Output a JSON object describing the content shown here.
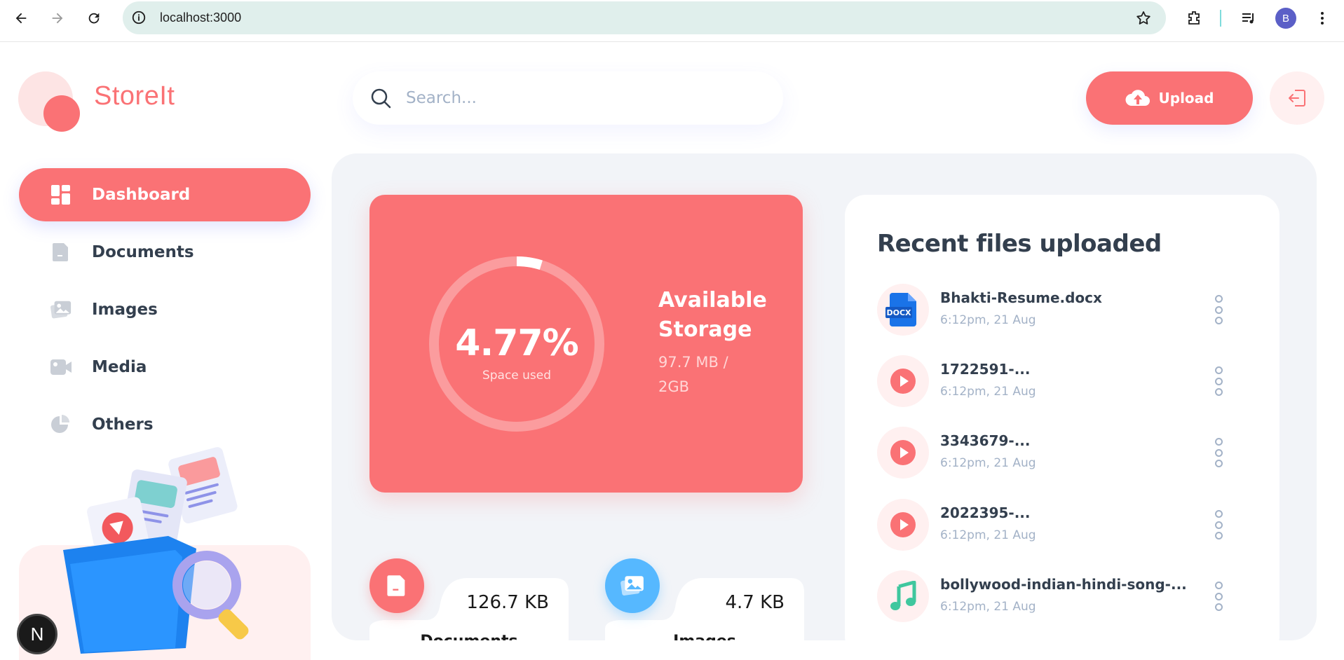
{
  "browser": {
    "url": "localhost:3000",
    "profile_initial": "B"
  },
  "app": {
    "name": "StoreIt",
    "search_placeholder": "Search...",
    "upload_label": "Upload"
  },
  "sidebar": {
    "items": [
      {
        "label": "Dashboard",
        "icon": "dashboard-icon",
        "active": true
      },
      {
        "label": "Documents",
        "icon": "document-icon",
        "active": false
      },
      {
        "label": "Images",
        "icon": "images-icon",
        "active": false
      },
      {
        "label": "Media",
        "icon": "video-icon",
        "active": false
      },
      {
        "label": "Others",
        "icon": "pie-chart-icon",
        "active": false
      }
    ]
  },
  "storage": {
    "percent_label": "4.77%",
    "percent_value": 4.77,
    "caption": "Space used",
    "title": "Available Storage",
    "used_label": "97.7 MB / 2GB"
  },
  "categories": [
    {
      "title": "Documents",
      "size": "126.7 KB",
      "icon": "document-icon",
      "color": "#fa7275"
    },
    {
      "title": "Images",
      "size": "4.7 KB",
      "icon": "image-icon",
      "color": "#56b8ff"
    }
  ],
  "recent": {
    "title": "Recent files uploaded",
    "files": [
      {
        "name": "Bhakti-Resume.docx",
        "date": "6:12pm, 21 Aug",
        "icon": "docx-icon"
      },
      {
        "name": "1722591-...",
        "date": "6:12pm, 21 Aug",
        "icon": "video-play-icon"
      },
      {
        "name": "3343679-...",
        "date": "6:12pm, 21 Aug",
        "icon": "video-play-icon"
      },
      {
        "name": "2022395-...",
        "date": "6:12pm, 21 Aug",
        "icon": "video-play-icon"
      },
      {
        "name": "bollywood-indian-hindi-song-...",
        "date": "6:12pm, 21 Aug",
        "icon": "music-icon"
      }
    ]
  },
  "colors": {
    "brand": "#fa7275",
    "text": "#333F4E",
    "muted": "#A3B2C7",
    "panel": "#f2f4f8",
    "image_accent": "#56b8ff"
  }
}
